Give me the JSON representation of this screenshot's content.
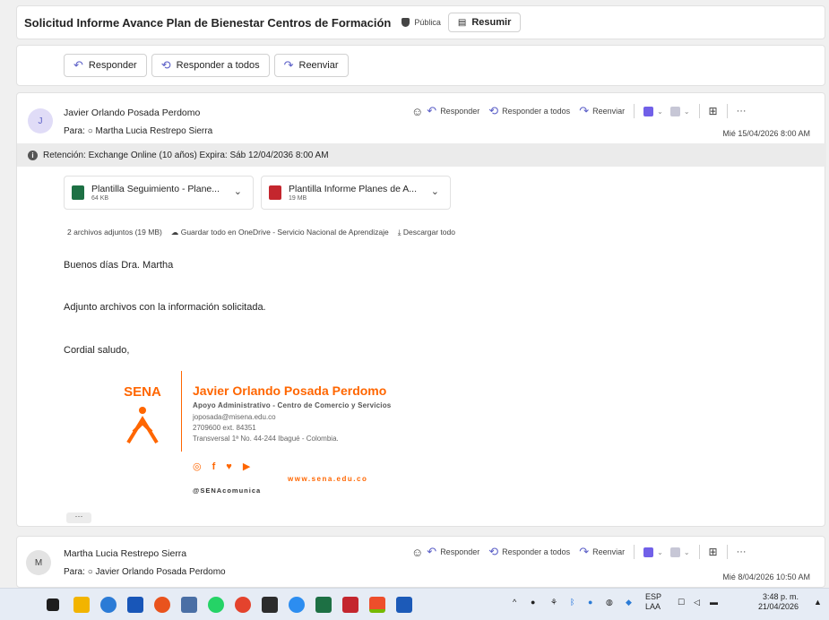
{
  "subject": {
    "title": "Solicitud Informe Avance Plan de Bienestar Centros de Formación",
    "sensitivity": "Pública",
    "summarize_label": "Resumir"
  },
  "actions": {
    "reply": "Responder",
    "reply_all": "Responder a todos",
    "forward": "Reenviar"
  },
  "message1": {
    "avatar_initial": "J",
    "sender": "Javier Orlando Posada Perdomo",
    "to_prefix": "Para:",
    "to": "Martha Lucia Restrepo Sierra",
    "date": "Mié 15/04/2026 8:00 AM",
    "retention": "Retención: Exchange Online (10 años) Expira: Sáb 12/04/2036 8:00 AM",
    "attachments": [
      {
        "name": "Plantilla Seguimiento - Plane...",
        "size": "64 KB",
        "type": "excel"
      },
      {
        "name": "Plantilla Informe Planes de A...",
        "size": "19 MB",
        "type": "pdf"
      }
    ],
    "attach_summary": "2 archivos adjuntos (19 MB)",
    "save_onedrive": "Guardar todo en OneDrive - Servicio Nacional de Aprendizaje",
    "download_all": "Descargar todo",
    "body": [
      "Buenos días Dra. Martha",
      "Adjunto archivos con la información solicitada.",
      "Cordial saludo,"
    ],
    "signature": {
      "logo_text": "SENA",
      "name": "Javier Orlando Posada Perdomo",
      "role": "Apoyo Administrativo - Centro de Comercio y Servicios",
      "email": "joposada@misena.edu.co",
      "phone": "2709600 ext. 84351",
      "address": "Transversal 1ª No. 44-244 Ibagué - Colombia.",
      "web": "www.sena.edu.co",
      "handle": "@SENAcomunica"
    },
    "more_label": "···"
  },
  "message2": {
    "avatar_initial": "M",
    "sender": "Martha Lucia Restrepo Sierra",
    "to_prefix": "Para:",
    "to": "Javier Orlando Posada Perdomo",
    "date": "Mié 8/04/2026 10:50 AM"
  },
  "taskbar": {
    "lang": "ESP",
    "lang2": "LAA",
    "time": "3:48 p. m.",
    "date": "21/04/2026"
  },
  "colors": {
    "accent": "#5b5fc7",
    "sena_orange": "#ff6600"
  }
}
